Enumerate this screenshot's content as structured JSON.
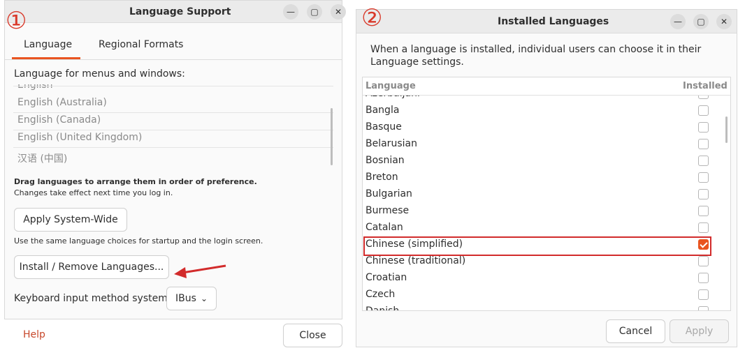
{
  "badges": {
    "one": "①",
    "two": "②"
  },
  "window1": {
    "title": "Language Support",
    "tabs": [
      {
        "label": "Language"
      },
      {
        "label": "Regional Formats"
      }
    ],
    "menus_label": "Language for menus and windows:",
    "languages": [
      "English",
      "English (Australia)",
      "English (Canada)",
      "English (United Kingdom)",
      "汉语 (中国)"
    ],
    "drag_hint_bold": "Drag languages to arrange them in order of preference.",
    "drag_hint": "Changes take effect next time you log in.",
    "apply_button": "Apply System-Wide",
    "apply_hint": "Use the same language choices for startup and the login screen.",
    "install_button": "Install / Remove Languages...",
    "keyboard_label": "Keyboard input method system:",
    "keyboard_value": "IBus",
    "help_label": "Help",
    "close_button": "Close"
  },
  "window2": {
    "title": "Installed Languages",
    "description": "When a language is installed, individual users can choose it in their Language settings.",
    "columns": {
      "language": "Language",
      "installed": "Installed"
    },
    "rows": [
      {
        "name": "Azerbaijani",
        "installed": false
      },
      {
        "name": "Bangla",
        "installed": false
      },
      {
        "name": "Basque",
        "installed": false
      },
      {
        "name": "Belarusian",
        "installed": false
      },
      {
        "name": "Bosnian",
        "installed": false
      },
      {
        "name": "Breton",
        "installed": false
      },
      {
        "name": "Bulgarian",
        "installed": false
      },
      {
        "name": "Burmese",
        "installed": false
      },
      {
        "name": "Catalan",
        "installed": false
      },
      {
        "name": "Chinese (simplified)",
        "installed": true
      },
      {
        "name": "Chinese (traditional)",
        "installed": false
      },
      {
        "name": "Croatian",
        "installed": false
      },
      {
        "name": "Czech",
        "installed": false
      },
      {
        "name": "Danish",
        "installed": false
      }
    ],
    "cancel_button": "Cancel",
    "apply_button": "Apply"
  },
  "colors": {
    "accent": "#e95420",
    "annotation": "#d22b2b"
  }
}
